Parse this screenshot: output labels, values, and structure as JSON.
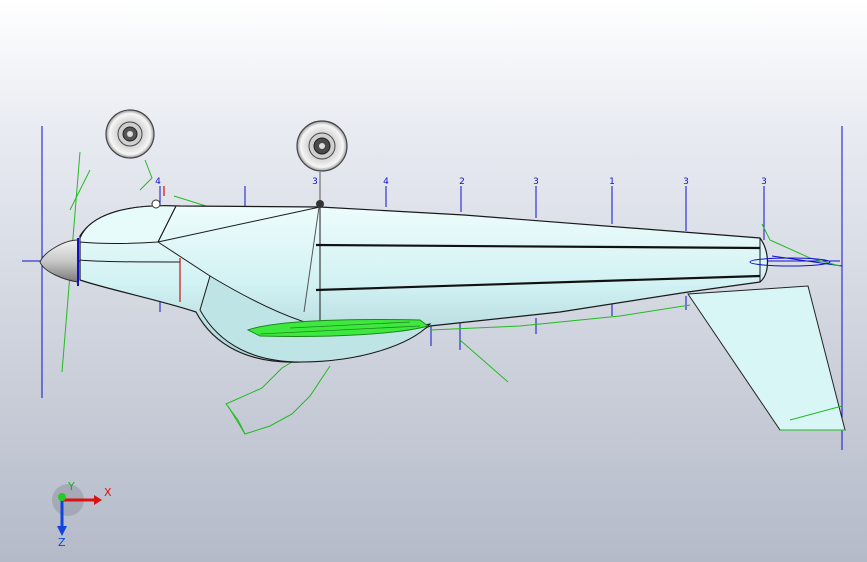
{
  "viewport": {
    "station_labels": [
      "4",
      "3",
      "4",
      "2",
      "3",
      "1",
      "3",
      "3"
    ]
  },
  "triad": {
    "x_label": "X",
    "y_label": "Y",
    "z_label": "Z"
  },
  "colors": {
    "background_top": "#ffffff",
    "background_bottom": "#b4bac8",
    "fuselage_fill": "#d7f4f4",
    "fuselage_edge": "#1a1a1a",
    "wing_green": "#22bb22",
    "construction_blue": "#1010cc",
    "highlight_green": "#3ee83e",
    "red_marker": "#cc1111"
  }
}
